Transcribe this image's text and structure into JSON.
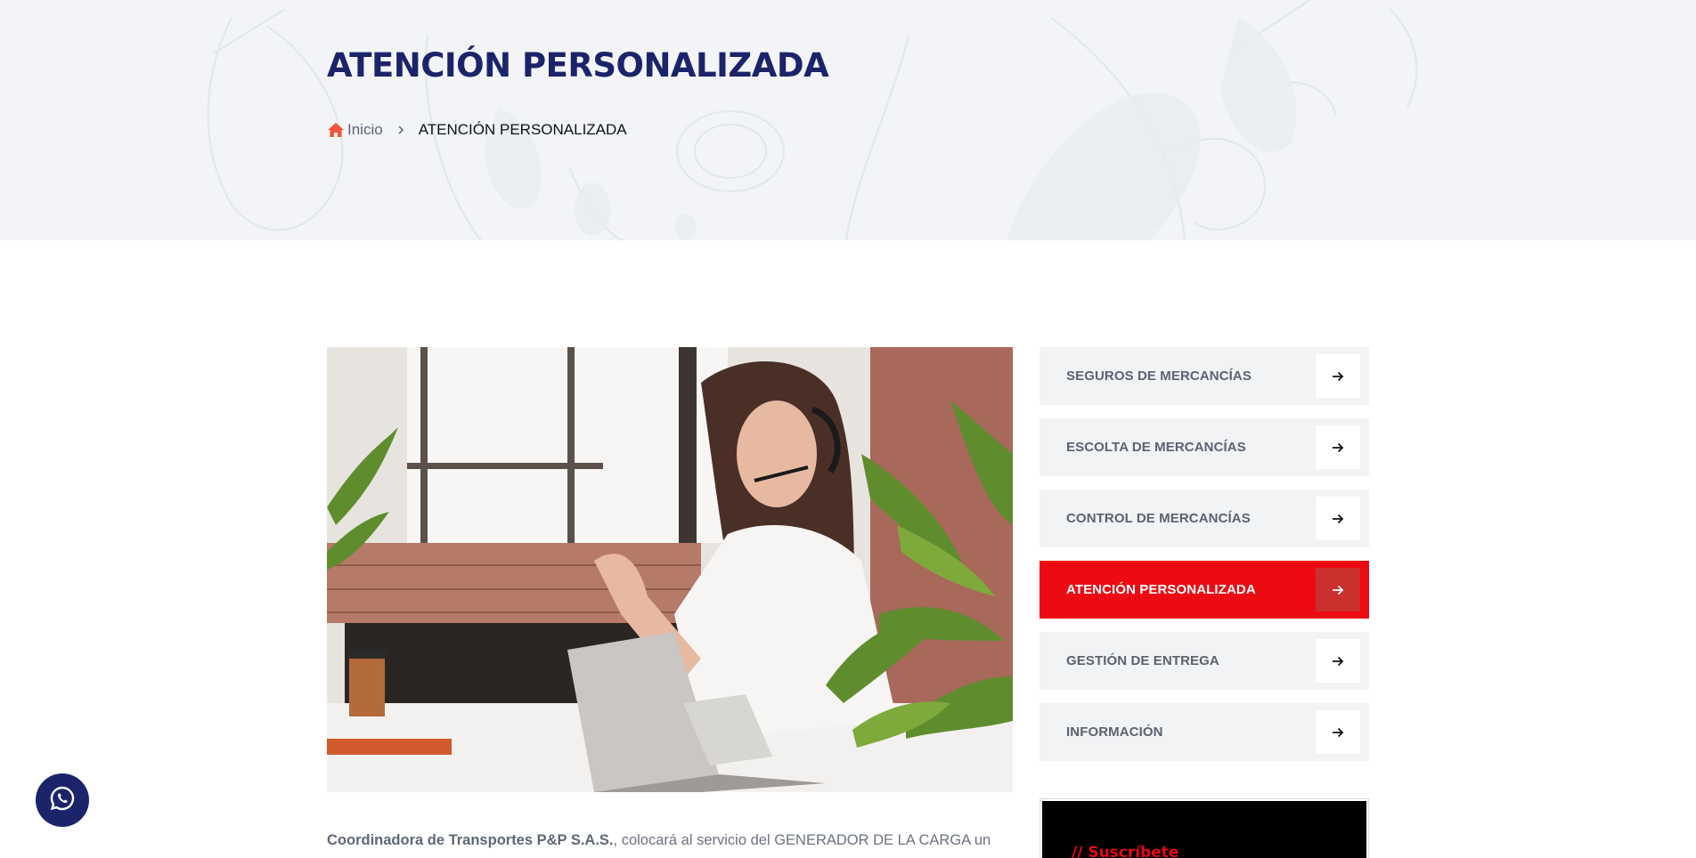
{
  "header": {
    "title": "ATENCIÓN PERSONALIZADA",
    "breadcrumb": {
      "home_icon": "home-icon",
      "home_label": "Inicio",
      "separator_icon": "chevron-right-icon",
      "current": "ATENCIÓN PERSONALIZADA"
    }
  },
  "hero": {
    "image": "woman-with-headset-at-laptop"
  },
  "intro": {
    "company": "Coordinadora de Transportes P&P S.A.S.",
    "text": ", colocará al servicio del GENERADOR DE LA CARGA un"
  },
  "sidebar": {
    "items": [
      {
        "label": "SEGUROS DE MERCANCÍAS",
        "active": false
      },
      {
        "label": "ESCOLTA DE MERCANCÍAS",
        "active": false
      },
      {
        "label": "CONTROL DE MERCANCÍAS",
        "active": false
      },
      {
        "label": "ATENCIÓN PERSONALIZADA",
        "active": true
      },
      {
        "label": "GESTIÓN DE ENTREGA",
        "active": false
      },
      {
        "label": "INFORMACIÓN",
        "active": false
      }
    ],
    "arrow_icon": "arrow-right-icon",
    "promo_text": "// Suscríbete"
  },
  "floating": {
    "whatsapp_icon": "whatsapp-icon"
  },
  "colors": {
    "brand_navy": "#1b246a",
    "accent_red": "#ec0b12",
    "banner_bg": "#f2f4f7",
    "menu_bg": "#f1f3f5"
  }
}
